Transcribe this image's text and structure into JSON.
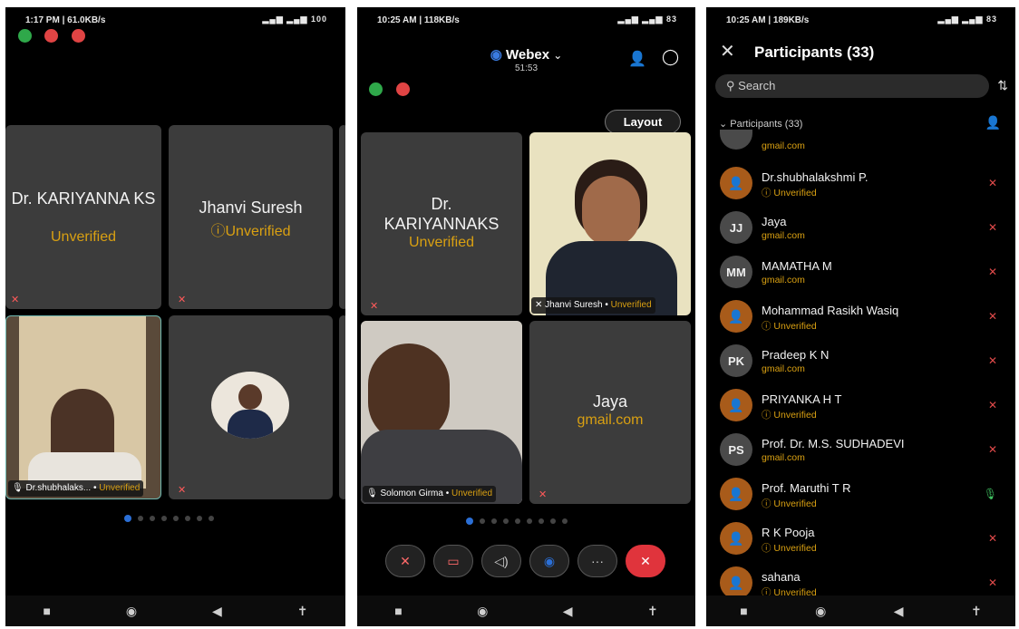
{
  "colors": {
    "unverified": "#d9a012",
    "accent_blue": "#2b6fd6",
    "end_red": "#e0343c",
    "avatar_orange": "#a85b1a"
  },
  "phone1": {
    "status_time": "1:17 PM | 61.0KB/s",
    "status_right": "100",
    "tiles": [
      {
        "name": "Dr. KARIYANNA KS",
        "sub": "Unverified"
      },
      {
        "name": "Jhanvi Suresh",
        "sub": "Unverified"
      },
      {
        "label_name": "Dr.shubhalaks...",
        "label_sub": "Unverified"
      }
    ]
  },
  "phone2": {
    "status_time": "10:25 AM | 118KB/s",
    "status_right": "83",
    "app_title": "Webex",
    "timer": "51:53",
    "layout_button": "Layout",
    "tiles": [
      {
        "name": "Dr. KARIYANNAKS",
        "sub": "Unverified"
      },
      {
        "label_name": "Jhanvi Suresh",
        "label_sub": "Unverified"
      },
      {
        "label_name": "Solomon Girma",
        "label_sub": "Unverified"
      },
      {
        "name": "Jaya",
        "sub": "gmail.com"
      }
    ]
  },
  "phone3": {
    "status_time": "10:25 AM | 189KB/s",
    "status_right": "83",
    "title": "Participants (33)",
    "search_placeholder": "Search",
    "section": "Participants (33)",
    "top_partial_sub": "gmail.com",
    "participants": [
      {
        "name": "Dr.shubhalakshmi P.",
        "sub": "Unverified",
        "initials": "",
        "avatar": "orange",
        "mic": "muted"
      },
      {
        "name": "Jaya",
        "sub": "gmail.com",
        "initials": "JJ",
        "avatar": "gray",
        "mic": "muted"
      },
      {
        "name": "MAMATHA M",
        "sub": "gmail.com",
        "initials": "MM",
        "avatar": "gray",
        "mic": "muted"
      },
      {
        "name": "Mohammad Rasikh Wasiq",
        "sub": "Unverified",
        "initials": "",
        "avatar": "orange",
        "mic": "muted"
      },
      {
        "name": "Pradeep K N",
        "sub": "gmail.com",
        "initials": "PK",
        "avatar": "gray",
        "mic": "muted"
      },
      {
        "name": "PRIYANKA H T",
        "sub": "Unverified",
        "initials": "",
        "avatar": "orange",
        "mic": "muted"
      },
      {
        "name": "Prof. Dr. M.S. SUDHADEVI",
        "sub": "gmail.com",
        "initials": "PS",
        "avatar": "gray",
        "mic": "muted"
      },
      {
        "name": "Prof. Maruthi T R",
        "sub": "Unverified",
        "initials": "",
        "avatar": "orange",
        "mic": "active"
      },
      {
        "name": "R K Pooja",
        "sub": "Unverified",
        "initials": "",
        "avatar": "orange",
        "mic": "muted"
      },
      {
        "name": "sahana",
        "sub": "Unverified",
        "initials": "",
        "avatar": "orange",
        "mic": "muted"
      }
    ]
  }
}
